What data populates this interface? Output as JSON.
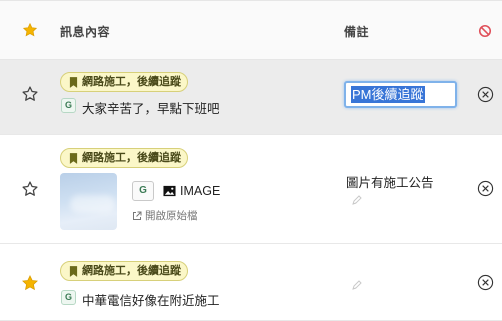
{
  "header": {
    "col_message": "訊息內容",
    "col_note": "備註"
  },
  "rows": [
    {
      "starred": false,
      "tag": "網路施工，後續追蹤",
      "badge": "G",
      "message": "大家辛苦了，早點下班吧",
      "note_editing": true,
      "note_value": "PM後續追蹤"
    },
    {
      "starred": false,
      "tag": "網路施工，後續追蹤",
      "badge": "G",
      "attachment_label": "IMAGE",
      "open_original": "開啟原始檔",
      "note": "圖片有施工公告"
    },
    {
      "starred": true,
      "tag": "網路施工，後續追蹤",
      "badge": "G",
      "message": "中華電信好像在附近施工",
      "note": ""
    }
  ],
  "colors": {
    "star_active": "#f5b400",
    "star_inactive": "#444444",
    "ban_icon": "#e0505a",
    "tag_bg": "#fbf7c8",
    "tag_border": "#d7d07a",
    "selection": "#3875d7",
    "header_bg": "#fafafa",
    "editing_row_bg": "#ececec"
  },
  "icons": {
    "header_star": "star-filled-icon",
    "header_ban": "ban-icon",
    "row_star": "star-outline-icon",
    "row_star_active": "star-filled-icon",
    "tag": "bookmark-icon",
    "image": "image-icon",
    "open": "external-link-icon",
    "edit": "pencil-icon",
    "remove": "close-circle-icon"
  }
}
